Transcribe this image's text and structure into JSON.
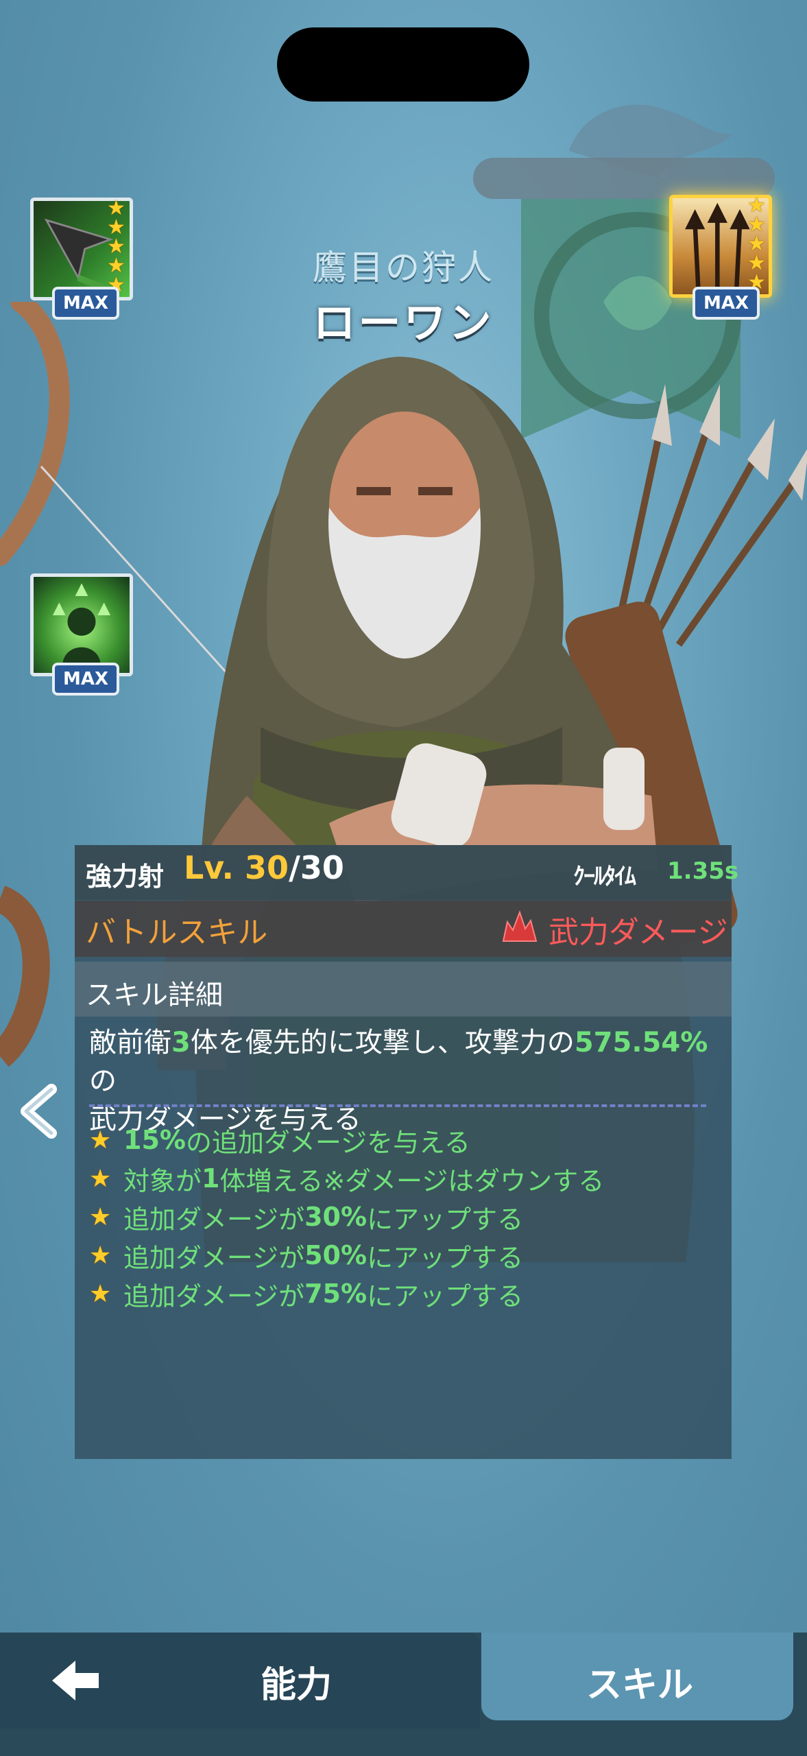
{
  "hero": {
    "epithet": "鷹目の狩人",
    "name": "ローワン"
  },
  "skill_icons": [
    {
      "name": "arrow-skill-icon",
      "badge": "MAX",
      "stars": 5,
      "selected": false
    },
    {
      "name": "trident-arrows-skill-icon",
      "badge": "MAX",
      "stars": 5,
      "selected": true
    },
    {
      "name": "summon-spirits-skill-icon",
      "badge": "MAX",
      "stars": 0,
      "selected": false
    }
  ],
  "skill": {
    "name": "強力射",
    "level_label": "Lv. 30",
    "level_max": "/30",
    "cooldown_label": "ｸｰﾙﾀｲﾑ",
    "cooldown_value": "1.35s",
    "type": "バトルスキル",
    "damage_type": "武力ダメージ",
    "detail_title": "スキル詳細",
    "description_parts": [
      "敵前衛",
      "3",
      "体を優先的に攻撃し、攻撃力の",
      "575.54%",
      "の",
      "武力ダメージを与える"
    ],
    "effects": [
      [
        "15%",
        "の追加ダメージを与える"
      ],
      [
        "対象が",
        "1",
        "体増える※ダメージはダウンする"
      ],
      [
        "追加ダメージが",
        "30%",
        "にアップする"
      ],
      [
        "追加ダメージが",
        "50%",
        "にアップする"
      ],
      [
        "追加ダメージが",
        "75%",
        "にアップする"
      ]
    ]
  },
  "tabs": {
    "ability": "能力",
    "skill": "スキル",
    "active": "skill"
  },
  "colors": {
    "background": "#5c97b3",
    "highlight_green": "#6fe07a",
    "level_gold": "#ffc93a",
    "battle_orange": "#f2a23a",
    "damage_red": "#ff5a5a"
  }
}
